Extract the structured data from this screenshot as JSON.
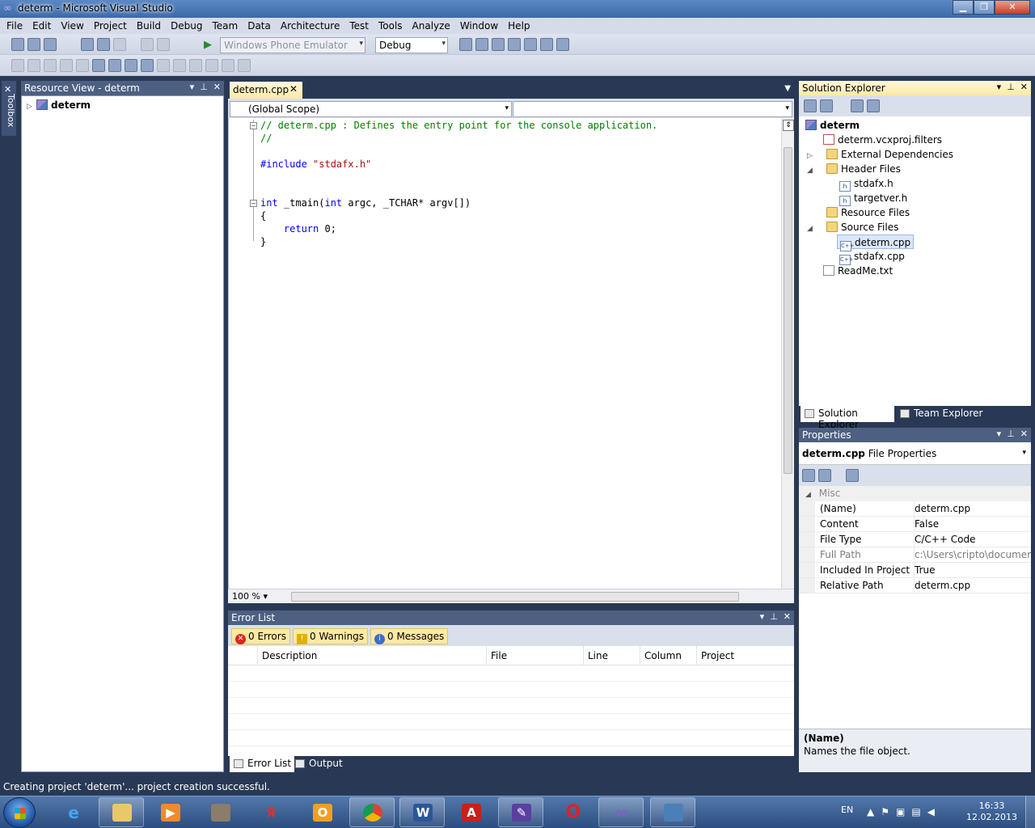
{
  "window": {
    "title": "determ - Microsoft Visual Studio"
  },
  "menu": [
    "File",
    "Edit",
    "View",
    "Project",
    "Build",
    "Debug",
    "Team",
    "Data",
    "Architecture",
    "Test",
    "Tools",
    "Analyze",
    "Window",
    "Help"
  ],
  "toolbar": {
    "target_device": "Windows Phone Emulator",
    "configuration": "Debug"
  },
  "toolbox": {
    "label": "Toolbox"
  },
  "resource_view": {
    "title": "Resource View - determ",
    "root": "determ"
  },
  "editor": {
    "tab": "determ.cpp",
    "scope": "(Global Scope)",
    "member": "",
    "zoom": "100 %",
    "lines": {
      "l1": "// determ.cpp : Defines the entry point for the console application.",
      "l2": "//",
      "l4_kw": "#include",
      "l4_str": "\"stdafx.h\"",
      "l7_kw1": "int",
      "l7_mid": " _tmain(",
      "l7_kw2": "int",
      "l7_rest": " argc, _TCHAR* argv[])",
      "l8": "{",
      "l9_kw": "return",
      "l9_rest": " 0;",
      "l10": "}"
    }
  },
  "error_list": {
    "title": "Error List",
    "errors": "0 Errors",
    "warnings": "0 Warnings",
    "messages": "0 Messages",
    "columns": [
      "Description",
      "File",
      "Line",
      "Column",
      "Project"
    ]
  },
  "bottom_tabs": {
    "error_list": "Error List",
    "output": "Output"
  },
  "solution_explorer": {
    "title": "Solution Explorer",
    "items": {
      "project": "determ",
      "filters": "determ.vcxproj.filters",
      "ext_deps": "External Dependencies",
      "header_files": "Header Files",
      "stdafx_h": "stdafx.h",
      "targetver_h": "targetver.h",
      "resource_files": "Resource Files",
      "source_files": "Source Files",
      "determ_cpp": "determ.cpp",
      "stdafx_cpp": "stdafx.cpp",
      "readme": "ReadMe.txt"
    },
    "tabs": {
      "solution": "Solution Explorer",
      "team": "Team Explorer"
    }
  },
  "properties": {
    "title": "Properties",
    "object_name": "determ.cpp",
    "object_type": "File Properties",
    "category": "Misc",
    "rows": [
      {
        "key": "(Name)",
        "value": "determ.cpp"
      },
      {
        "key": "Content",
        "value": "False"
      },
      {
        "key": "File Type",
        "value": "C/C++ Code"
      },
      {
        "key": "Full Path",
        "value": "c:\\Users\\cripto\\documents"
      },
      {
        "key": "Included In Project",
        "value": "True"
      },
      {
        "key": "Relative Path",
        "value": "determ.cpp"
      }
    ],
    "desc_title": "(Name)",
    "desc_text": "Names the file object."
  },
  "status": {
    "text": "Creating project 'determ'... project creation successful."
  },
  "taskbar": {
    "lang": "EN",
    "time": "16:33",
    "date": "12.02.2013"
  },
  "colors": {
    "comment": "#008000",
    "keyword": "#0000ff",
    "string": "#a31515",
    "chrome": "#293955"
  }
}
